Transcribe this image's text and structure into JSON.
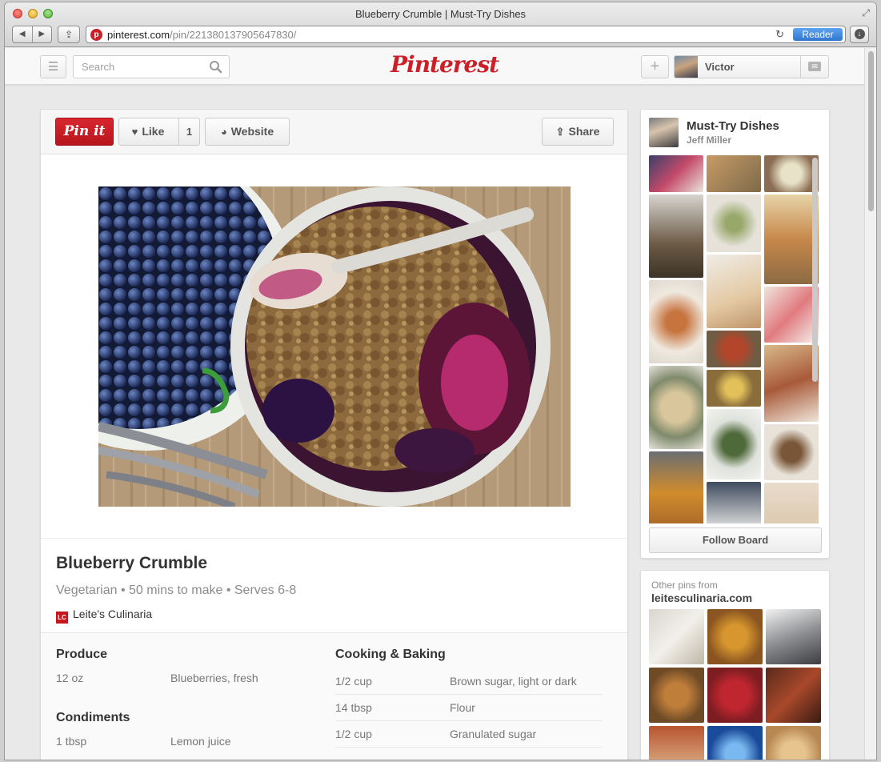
{
  "browser": {
    "window_title": "Blueberry Crumble | Must-Try Dishes",
    "url_host": "pinterest.com",
    "url_path": "/pin/221380137905647830/",
    "reader_label": "Reader"
  },
  "header": {
    "search_placeholder": "Search",
    "logo_text": "Pinterest",
    "user_name": "Victor",
    "brand_color": "#cb2027"
  },
  "actions": {
    "pinit_label": "Pin it",
    "like_label": "Like",
    "like_count": "1",
    "website_label": "Website",
    "share_label": "Share"
  },
  "pin": {
    "image_icon": "blueberry-crumble-photo",
    "title": "Blueberry Crumble",
    "meta": "Vegetarian • 50 mins to make • Serves 6-8",
    "source_logo": "LC",
    "source_name": "Leite's Culinaria"
  },
  "ingredients": {
    "produce": {
      "heading": "Produce",
      "items": [
        {
          "qty": "12 oz",
          "name": "Blueberries, fresh"
        }
      ]
    },
    "condiments": {
      "heading": "Condiments",
      "items": [
        {
          "qty": "1 tbsp",
          "name": "Lemon juice"
        }
      ]
    },
    "cooking": {
      "heading": "Cooking & Baking",
      "items": [
        {
          "qty": "1/2 cup",
          "name": "Brown sugar, light or dark"
        },
        {
          "qty": "14 tbsp",
          "name": "Flour"
        },
        {
          "qty": "1/2 cup",
          "name": "Granulated sugar"
        }
      ]
    }
  },
  "board": {
    "name": "Must-Try Dishes",
    "owner": "Jeff Miller",
    "follow_label": "Follow Board"
  },
  "other_pins": {
    "label": "Other pins from",
    "domain": "leitesculinaria.com"
  }
}
